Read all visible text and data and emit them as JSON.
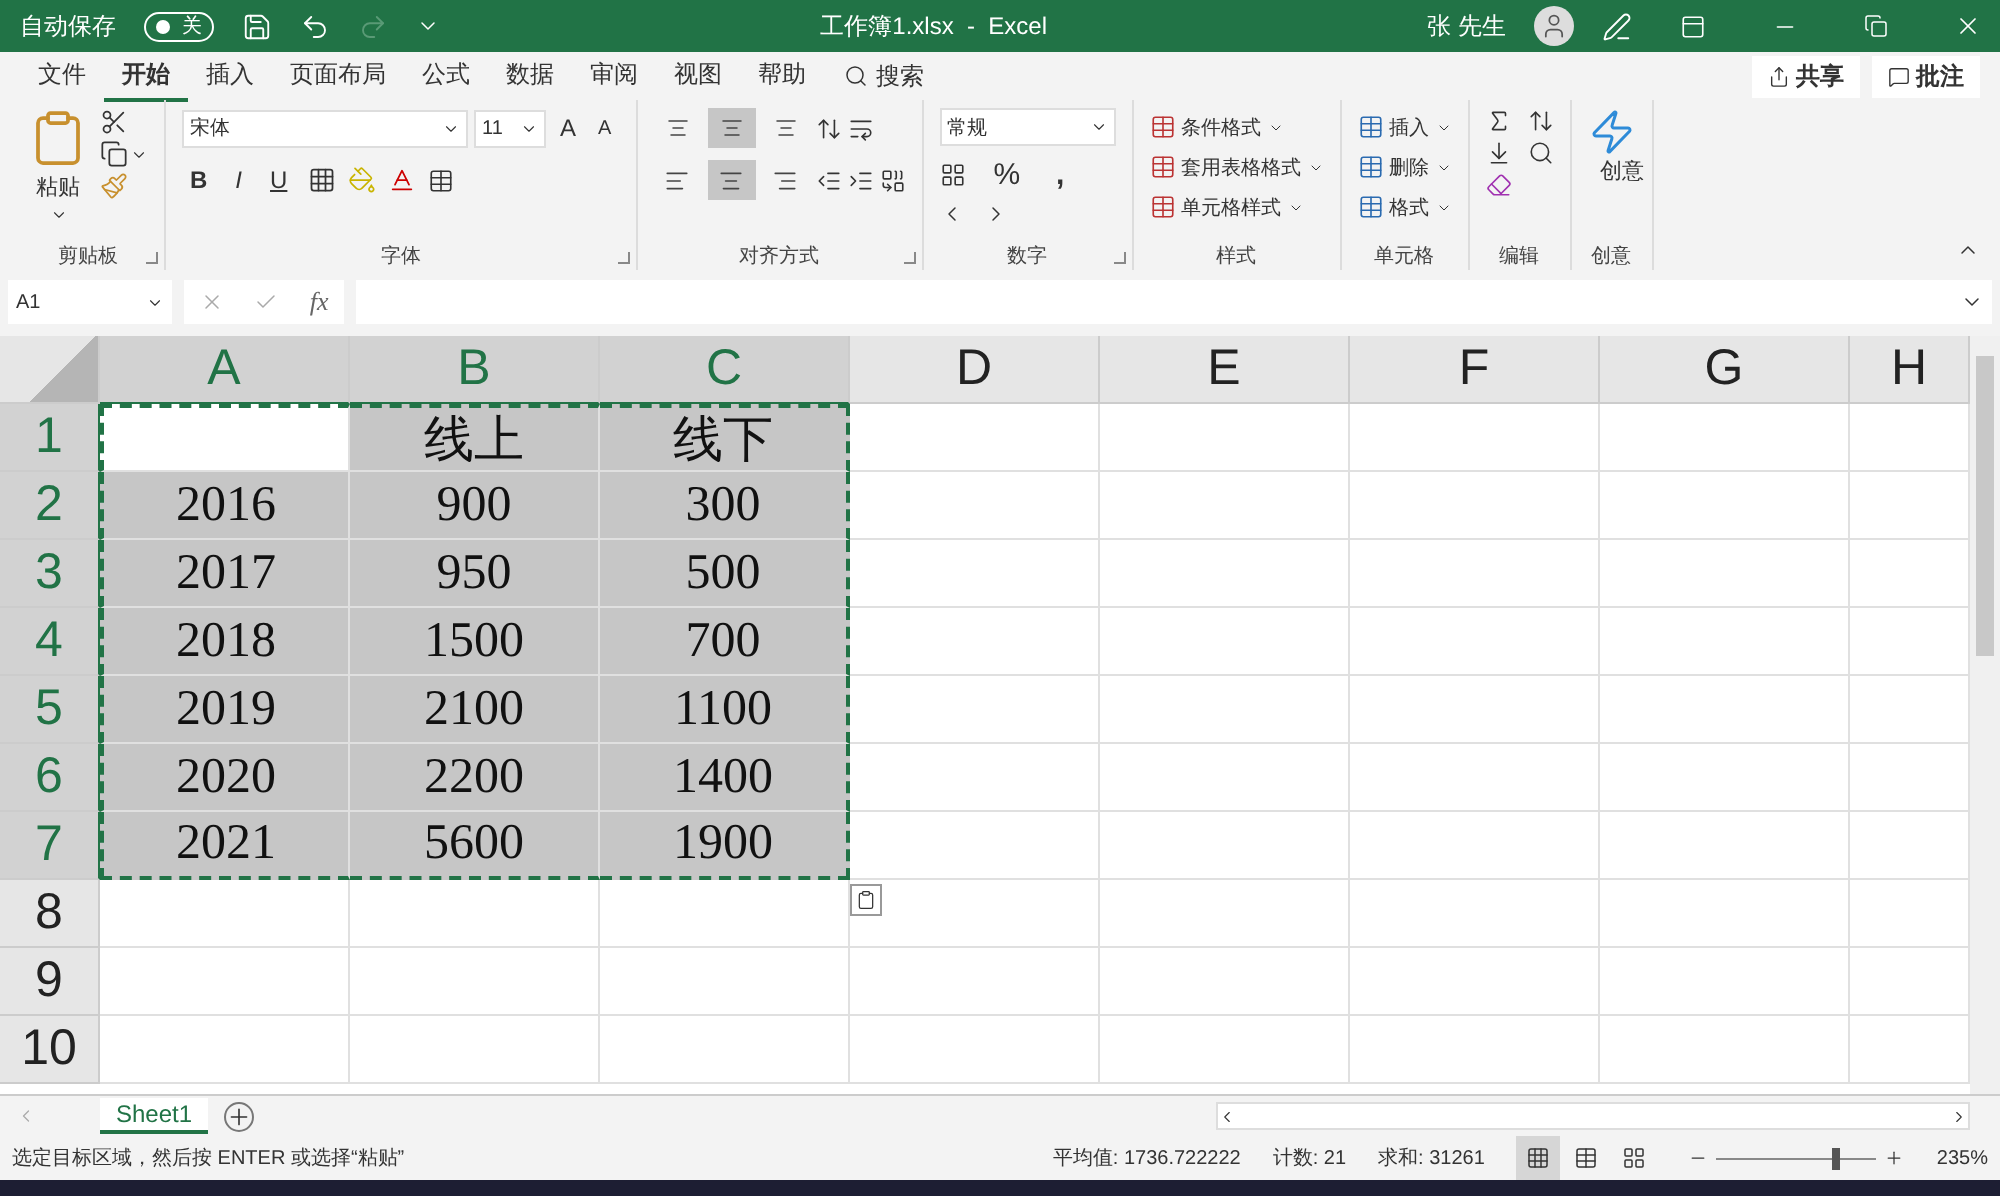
{
  "title_bar": {
    "autosave_label": "自动保存",
    "autosave_on": false,
    "autosave_state": "关",
    "title": "工作簿1.xlsx  -  Excel",
    "user": "张 先生"
  },
  "menu_tabs": [
    {
      "label": "文件",
      "selected": false
    },
    {
      "label": "开始",
      "selected": true
    },
    {
      "label": "插入",
      "selected": false
    },
    {
      "label": "页面布局",
      "selected": false
    },
    {
      "label": "公式",
      "selected": false
    },
    {
      "label": "数据",
      "selected": false
    },
    {
      "label": "审阅",
      "selected": false
    },
    {
      "label": "视图",
      "selected": false
    },
    {
      "label": "帮助",
      "selected": false
    }
  ],
  "search": {
    "label": "搜索"
  },
  "share_button": "共享",
  "comments_button": "批注",
  "ribbon": {
    "clipboard": {
      "label": "剪贴板",
      "paste": "粘贴"
    },
    "font": {
      "label": "字体",
      "font_name": "宋体",
      "font_size": "11",
      "grow": "A",
      "shrink": "A",
      "bold": "B",
      "italic": "I",
      "underline": "U"
    },
    "alignment": {
      "label": "对齐方式",
      "vertical": [
        {
          "selected": false
        },
        {
          "selected": true
        },
        {
          "selected": false
        }
      ],
      "horizontal": [
        {
          "selected": false
        },
        {
          "selected": true
        },
        {
          "selected": false
        }
      ]
    },
    "number": {
      "label": "数字",
      "format": "常规",
      "percent": "%",
      "comma": ","
    },
    "styles": {
      "label": "样式",
      "items": [
        "条件格式",
        "套用表格格式",
        "单元格样式"
      ]
    },
    "cells": {
      "label": "单元格",
      "items": [
        "插入",
        "删除",
        "格式"
      ]
    },
    "editing": {
      "label": "编辑"
    },
    "ideas": {
      "label": "创意",
      "button": "创意"
    }
  },
  "formula_bar": {
    "name_box": "A1",
    "fx": "fx"
  },
  "columns": [
    {
      "label": "A",
      "selected": true
    },
    {
      "label": "B",
      "selected": true
    },
    {
      "label": "C",
      "selected": true
    },
    {
      "label": "D",
      "selected": false
    },
    {
      "label": "E",
      "selected": false
    },
    {
      "label": "F",
      "selected": false
    },
    {
      "label": "G",
      "selected": false
    },
    {
      "label": "H",
      "selected": false
    }
  ],
  "rows": [
    {
      "header": "1",
      "selected": true,
      "cells": [
        null,
        "线上",
        "线下"
      ]
    },
    {
      "header": "2",
      "selected": true,
      "cells": [
        "2016",
        "900",
        "300"
      ]
    },
    {
      "header": "3",
      "selected": true,
      "cells": [
        "2017",
        "950",
        "500"
      ]
    },
    {
      "header": "4",
      "selected": true,
      "cells": [
        "2018",
        "1500",
        "700"
      ]
    },
    {
      "header": "5",
      "selected": true,
      "cells": [
        "2019",
        "2100",
        "1100"
      ]
    },
    {
      "header": "6",
      "selected": true,
      "cells": [
        "2020",
        "2200",
        "1400"
      ]
    },
    {
      "header": "7",
      "selected": true,
      "cells": [
        "2021",
        "5600",
        "1900"
      ]
    },
    {
      "header": "8",
      "selected": false,
      "cells": []
    },
    {
      "header": "9",
      "selected": false,
      "cells": []
    },
    {
      "header": "10",
      "selected": false,
      "cells": []
    }
  ],
  "paste_options_shown": true,
  "sheet_tabs": [
    {
      "label": "Sheet1",
      "selected": true
    }
  ],
  "status_bar": {
    "message": "选定目标区域，然后按 ENTER 或选择“粘贴”",
    "average": "平均值: 1736.722222",
    "count": "计数: 21",
    "sum": "求和: 31261",
    "view": [
      {
        "selected": true
      },
      {
        "selected": false
      },
      {
        "selected": false
      }
    ],
    "zoom": {
      "level": 0.75,
      "reading": "235%"
    }
  }
}
